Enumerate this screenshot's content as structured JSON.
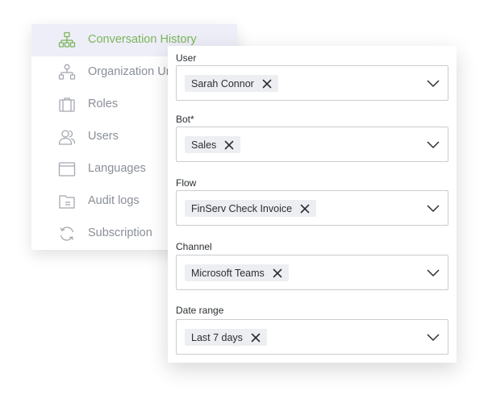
{
  "sidebar": {
    "items": [
      {
        "label": "Conversation History",
        "icon": "sitemap-icon",
        "active": true
      },
      {
        "label": "Organization Units",
        "icon": "sitemap-icon",
        "active": false
      },
      {
        "label": "Roles",
        "icon": "briefcase-icon",
        "active": false
      },
      {
        "label": "Users",
        "icon": "users-icon",
        "active": false
      },
      {
        "label": "Languages",
        "icon": "window-icon",
        "active": false
      },
      {
        "label": "Audit logs",
        "icon": "folder-icon",
        "active": false
      },
      {
        "label": "Subscription",
        "icon": "refresh-icon",
        "active": false
      }
    ],
    "colors": {
      "active_text": "#7bb55a",
      "active_bg": "#eeeef8",
      "text": "#8a8f98"
    }
  },
  "filters": {
    "user": {
      "label": "User",
      "value": "Sarah Connor"
    },
    "bot": {
      "label": "Bot*",
      "value": "Sales"
    },
    "flow": {
      "label": "Flow",
      "value": "FinServ Check Invoice"
    },
    "channel": {
      "label": "Channel",
      "value": "Microsoft Teams"
    },
    "date_range": {
      "label": "Date range",
      "value": "Last 7 days"
    }
  }
}
